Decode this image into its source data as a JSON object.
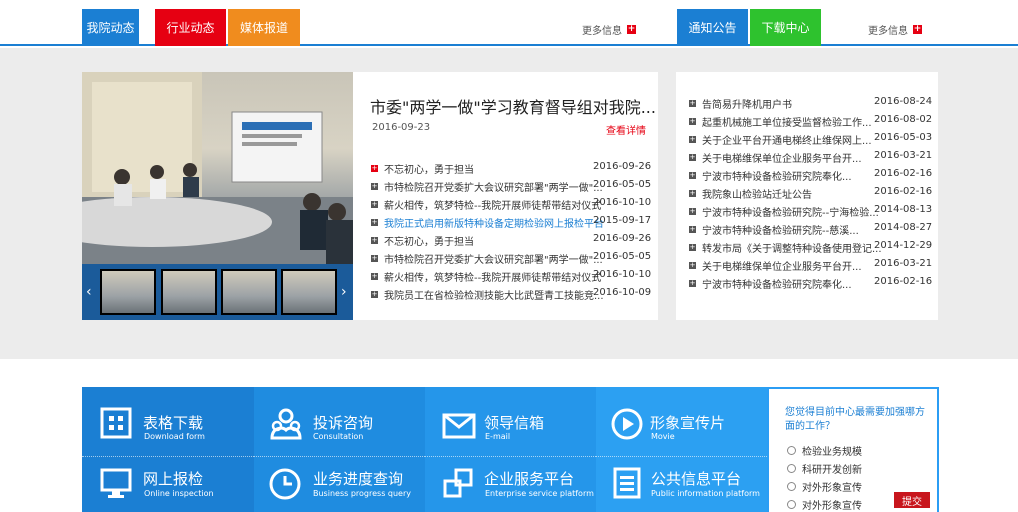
{
  "top_tabs": [
    {
      "label": "我院动态",
      "color": "#1b7fd3"
    },
    {
      "label": "行业动态",
      "color": "#e60012"
    },
    {
      "label": "媒体报道",
      "color": "#f08c1e"
    }
  ],
  "more_left": "更多信息",
  "right_tabs": [
    {
      "label": "通知公告",
      "color": "#1b7fd3"
    },
    {
      "label": "下载中心",
      "color": "#2ec22e"
    }
  ],
  "more_right": "更多信息",
  "featured": {
    "title": "市委\"两学一做\"学习教育督导组对我院...",
    "date": "2016-09-23",
    "more": "查看详情"
  },
  "news": [
    {
      "text": "不忘初心，勇于担当",
      "date": "2016-09-26",
      "bullet": "red"
    },
    {
      "text": "市特检院召开党委扩大会议研究部署\"两学一做\"...",
      "date": "2016-05-05"
    },
    {
      "text": "薪火相传，筑梦特检--我院开展师徒帮带结对仪式",
      "date": "2016-10-10"
    },
    {
      "text": "我院正式启用新版特种设备定期检验网上报检平台",
      "date": "2015-09-17",
      "highlight": true
    },
    {
      "text": "不忘初心，勇于担当",
      "date": "2016-09-26"
    },
    {
      "text": "市特检院召开党委扩大会议研究部署\"两学一做\"...",
      "date": "2016-05-05"
    },
    {
      "text": "薪火相传，筑梦特检--我院开展师徒帮带结对仪式",
      "date": "2016-10-10"
    },
    {
      "text": "我院员工在省检验检测技能大比武暨青工技能竞...",
      "date": "2016-10-09"
    }
  ],
  "notices": [
    {
      "text": "告简易升降机用户书",
      "date": "2016-08-24"
    },
    {
      "text": "起重机械施工单位接受监督检验工作...",
      "date": "2016-08-02"
    },
    {
      "text": "关于企业平台开通电梯终止维保网上...",
      "date": "2016-05-03"
    },
    {
      "text": "关于电梯维保单位企业服务平台开...",
      "date": "2016-03-21"
    },
    {
      "text": "宁波市特种设备检验研究院奉化...",
      "date": "2016-02-16"
    },
    {
      "text": "我院象山检验站迁址公告",
      "date": "2016-02-16"
    },
    {
      "text": "宁波市特种设备检验研究院--宁海检验...",
      "date": "2014-08-13"
    },
    {
      "text": "宁波市特种设备检验研究院--慈溪...",
      "date": "2014-08-27"
    },
    {
      "text": "转发市局《关于调整特种设备使用登记...",
      "date": "2014-12-29"
    },
    {
      "text": "关于电梯维保单位企业服务平台开...",
      "date": "2016-03-21"
    },
    {
      "text": "宁波市特种设备检验研究院奉化...",
      "date": "2016-02-16"
    }
  ],
  "services": [
    {
      "title": "表格下载",
      "sub": "Download form",
      "icon": "grid-icon",
      "bg": "#1b7fd3"
    },
    {
      "title": "投诉咨询",
      "sub": "Consultation",
      "icon": "people-icon",
      "bg": "#1f8ce0"
    },
    {
      "title": "领导信箱",
      "sub": "E-mail",
      "icon": "mail-icon",
      "bg": "#2596ea"
    },
    {
      "title": "形象宣传片",
      "sub": "Movie",
      "icon": "play-icon",
      "bg": "#2ca0f2"
    },
    {
      "title": "网上报检",
      "sub": "Online inspection",
      "icon": "monitor-icon",
      "bg": "#1b7fd3"
    },
    {
      "title": "业务进度查询",
      "sub": "Business progress query",
      "icon": "clock-icon",
      "bg": "#1f8ce0"
    },
    {
      "title": "企业服务平台",
      "sub": "Enterprise service platform",
      "icon": "link-icon",
      "bg": "#2596ea"
    },
    {
      "title": "公共信息平台",
      "sub": "Public information platform",
      "icon": "document-icon",
      "bg": "#2ca0f2"
    }
  ],
  "survey": {
    "question": "您觉得目前中心最需要加强哪方面的工作？",
    "options": [
      "检验业务规模",
      "科研开发创新",
      "对外形象宣传",
      "对外形象宣传"
    ],
    "submit": "提交"
  }
}
